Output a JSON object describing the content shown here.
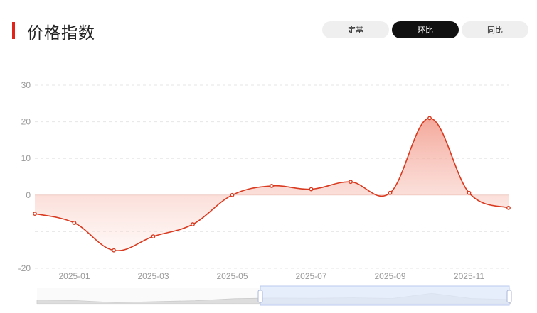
{
  "header": {
    "title": "价格指数",
    "tabs": [
      {
        "label": "定基",
        "active": false
      },
      {
        "label": "环比",
        "active": true
      },
      {
        "label": "同比",
        "active": false
      }
    ]
  },
  "colors": {
    "accent": "#e2231a",
    "line": "#d93a1f",
    "area": "#f7b0a0",
    "zoom": "#dfe8fb"
  },
  "chart_data": {
    "type": "area",
    "x": [
      "2024-12",
      "2025-01",
      "2025-02",
      "2025-03",
      "2025-04",
      "2025-05",
      "2025-06",
      "2025-07",
      "2025-08",
      "2025-09",
      "2025-10",
      "2025-11",
      "2025-12"
    ],
    "values": [
      -5.1,
      -7.6,
      -15.1,
      -11.3,
      -8.0,
      0.0,
      2.5,
      1.6,
      3.6,
      0.6,
      21.0,
      0.6,
      -3.5
    ],
    "ylim": [
      -20,
      30
    ],
    "yticks": [
      "30",
      "20",
      "10",
      "0",
      "-20"
    ],
    "xticks": [
      "2025-01",
      "2025-03",
      "2025-05",
      "2025-07",
      "2025-09",
      "2025-11"
    ],
    "grid": true,
    "xlabel": "",
    "ylabel": ""
  }
}
